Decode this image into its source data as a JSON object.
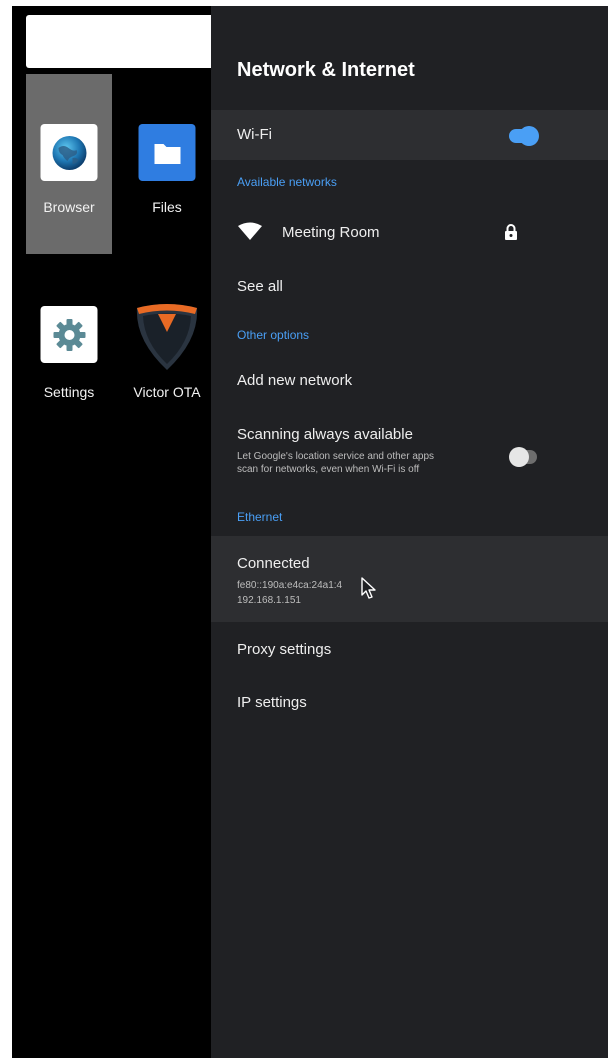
{
  "launcher": {
    "apps": [
      {
        "label": "Browser",
        "icon": "globe-icon",
        "selected": true
      },
      {
        "label": "Files",
        "icon": "folder-icon",
        "selected": false
      },
      {
        "label": "Settings",
        "icon": "gear-icon",
        "selected": false
      },
      {
        "label": "Victor OTA",
        "icon": "shield-logo-icon",
        "selected": false
      }
    ]
  },
  "panel": {
    "title": "Network & Internet",
    "wifi": {
      "label": "Wi-Fi",
      "enabled": true
    },
    "available_networks_header": "Available networks",
    "networks": [
      {
        "name": "Meeting Room",
        "icon": "wifi-icon",
        "secured_icon": "lock-icon"
      }
    ],
    "see_all": "See all",
    "other_options_header": "Other options",
    "add_network": "Add new network",
    "scanning": {
      "title": "Scanning always available",
      "description_line1": "Let Google's location service and other apps",
      "description_line2": "scan for networks, even when Wi-Fi is off",
      "enabled": false
    },
    "ethernet_header": "Ethernet",
    "ethernet": {
      "status": "Connected",
      "ipv6": "fe80::190a:e4ca:24a1:4",
      "ipv4": "192.168.1.151"
    },
    "proxy_settings": "Proxy settings",
    "ip_settings": "IP settings"
  },
  "colors": {
    "accent": "#4a9ff5",
    "panel_bg": "#202124",
    "highlight_bg": "#2d2e31",
    "selected_app_bg": "#6b6b6b"
  }
}
